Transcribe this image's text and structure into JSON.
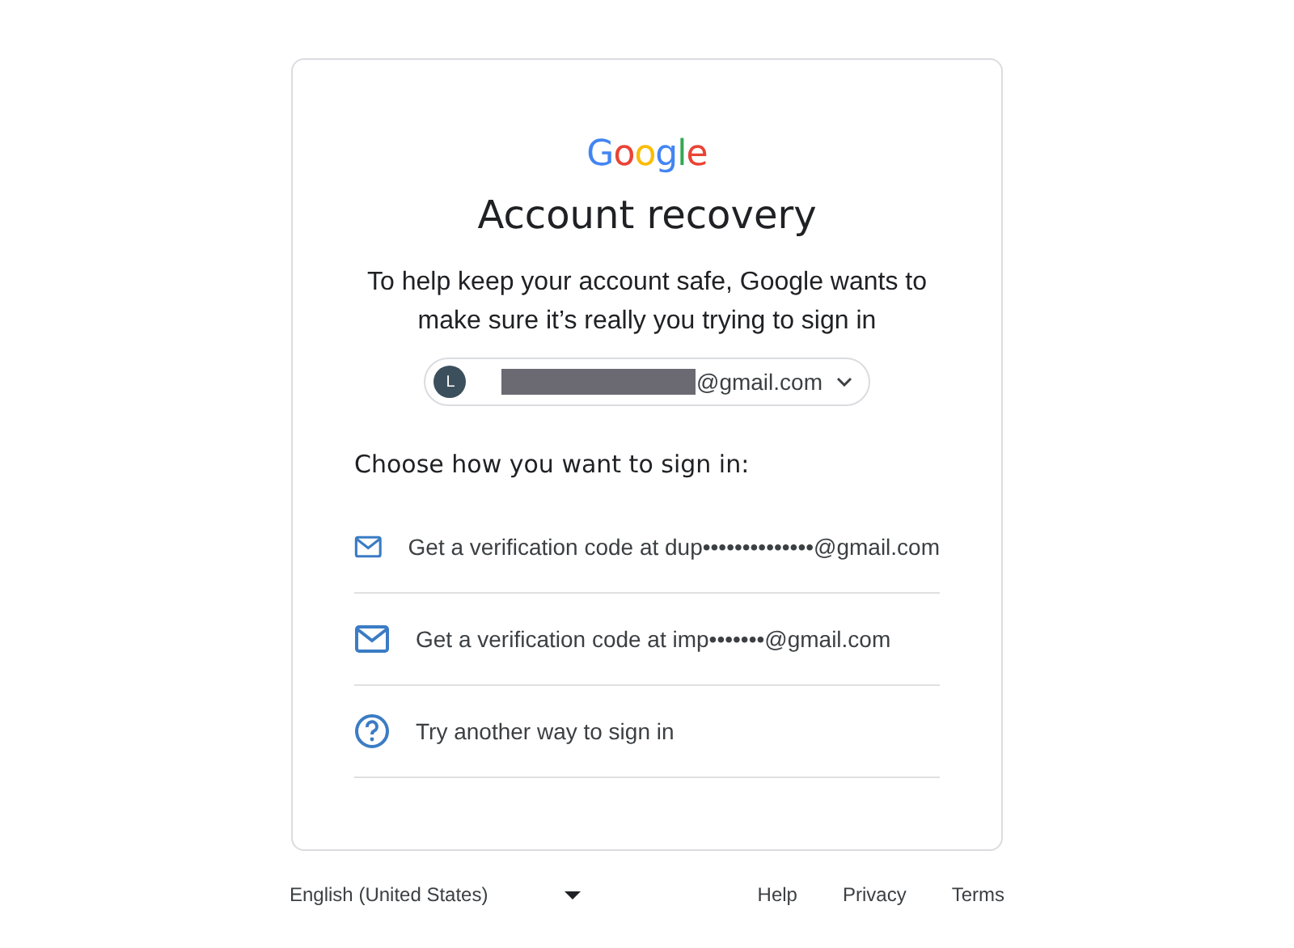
{
  "logo": "Google",
  "title": "Account recovery",
  "subtitle": "To help keep your account safe, Google wants to make sure it’s really you trying to sign in",
  "account": {
    "avatar": "L",
    "email": "@gmail.com",
    "redacted": true
  },
  "choose_heading": "Choose how you want to sign in:",
  "options": [
    {
      "kind": "email",
      "label": "Get a verification code at dup••••••••••••••@gmail.com"
    },
    {
      "kind": "email",
      "label": "Get a verification code at imp•••••••@gmail.com"
    },
    {
      "kind": "help",
      "label": "Try another way to sign in"
    }
  ],
  "footer": {
    "language": "English (United States)",
    "links": [
      "Help",
      "Privacy",
      "Terms"
    ]
  }
}
